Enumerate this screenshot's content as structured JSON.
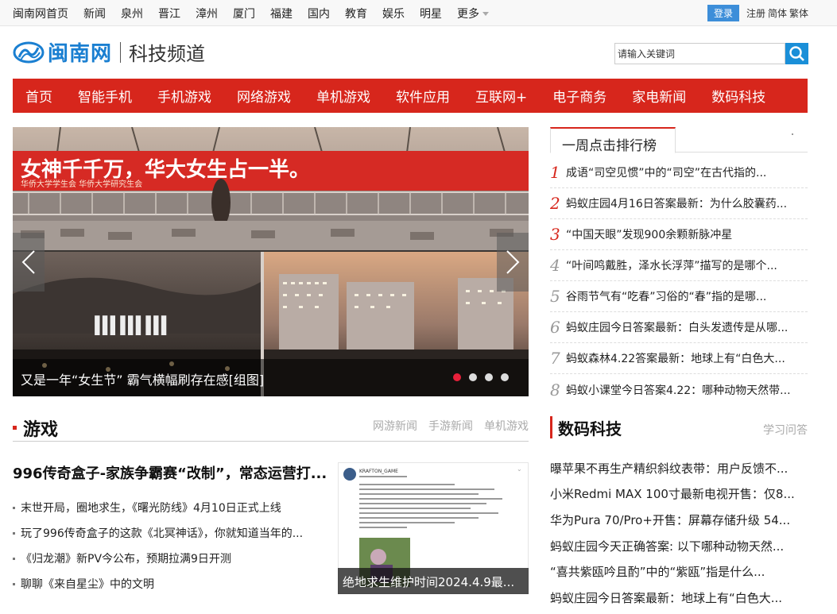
{
  "topnav": {
    "items": [
      "闽南网首页",
      "新闻",
      "泉州",
      "晋江",
      "漳州",
      "厦门",
      "福建",
      "国内",
      "教育",
      "娱乐",
      "明星"
    ],
    "more": "更多",
    "login": "登录",
    "register": "注册",
    "simplified": "简体",
    "traditional": "繁体"
  },
  "header": {
    "logo_text": "闽南网",
    "channel": "科技频道",
    "search_placeholder": "请输入关键词",
    "search_icon": "search-icon"
  },
  "mainnav": {
    "items": [
      "首页",
      "智能手机",
      "手机游戏",
      "网络游戏",
      "单机游戏",
      "软件应用",
      "互联网+",
      "电子商务",
      "家电新闻",
      "数码科技"
    ]
  },
  "slider": {
    "caption": "又是一年“女生节” 霸气横幅刷存在感[组图]",
    "banner_text": "女神千千万，华大女生占一半。",
    "banner_sub": "华侨大学学生会  华侨大学研究生会",
    "dot_count": 4,
    "active_dot": 1
  },
  "ranking": {
    "title": "一周点击排行榜",
    "items": [
      {
        "num": "1",
        "text": "成语“司空见惯”中的“司空”在古代指的..."
      },
      {
        "num": "2",
        "text": "蚂蚁庄园4月16日答案最新：为什么胶囊药..."
      },
      {
        "num": "3",
        "text": "“中国天眼”发现900余颗新脉冲星"
      },
      {
        "num": "4",
        "text": "“叶间鸣戴胜，泽水长浮萍”描写的是哪个..."
      },
      {
        "num": "5",
        "text": "谷雨节气有“吃春”习俗的“春”指的是哪..."
      },
      {
        "num": "6",
        "text": "蚂蚁庄园今日答案最新：白头发遗传是从哪..."
      },
      {
        "num": "7",
        "text": "蚂蚁森林4.22答案最新：地球上有“白色大..."
      },
      {
        "num": "8",
        "text": "蚂蚁小课堂今日答案4.22：哪种动物天然带..."
      }
    ]
  },
  "games": {
    "title": "游戏",
    "links": [
      "网游新闻",
      "手游新闻",
      "单机游戏"
    ],
    "lead": "996传奇盒子-家族争霸赛“改制”，常态运营打...",
    "items": [
      "末世开局，圈地求生，《曙光防线》4月10日正式上线",
      "玩了996传奇盒子的这款《北冥神话》，你就知道当年的...",
      "《归龙潮》新PV今公布，预期拉满9日开测",
      "聊聊《来自星尘》中的文明"
    ],
    "thumb_caption": "绝地求生维护时间2024.4.9最...",
    "thumb_header": "KRAFTON_GAME"
  },
  "digital": {
    "title": "数码科技",
    "link": "学习问答",
    "items": [
      "曝苹果不再生产精织斜纹表带：用户反馈不...",
      "小米Redmi MAX 100寸最新电视开售：仅8...",
      "华为Pura 70/Pro+开售：屏幕存储升级 54...",
      "蚂蚁庄园今天正确答案: 以下哪种动物天然...",
      "“喜共紫瓯吟且酌”中的“紫瓯”指是什么...",
      "蚂蚁庄园今日答案最新：地球上有“白色大..."
    ]
  },
  "colors": {
    "brand_red": "#d7261c",
    "brand_blue": "#1a7fd1",
    "active_dot": "#e8203a"
  }
}
